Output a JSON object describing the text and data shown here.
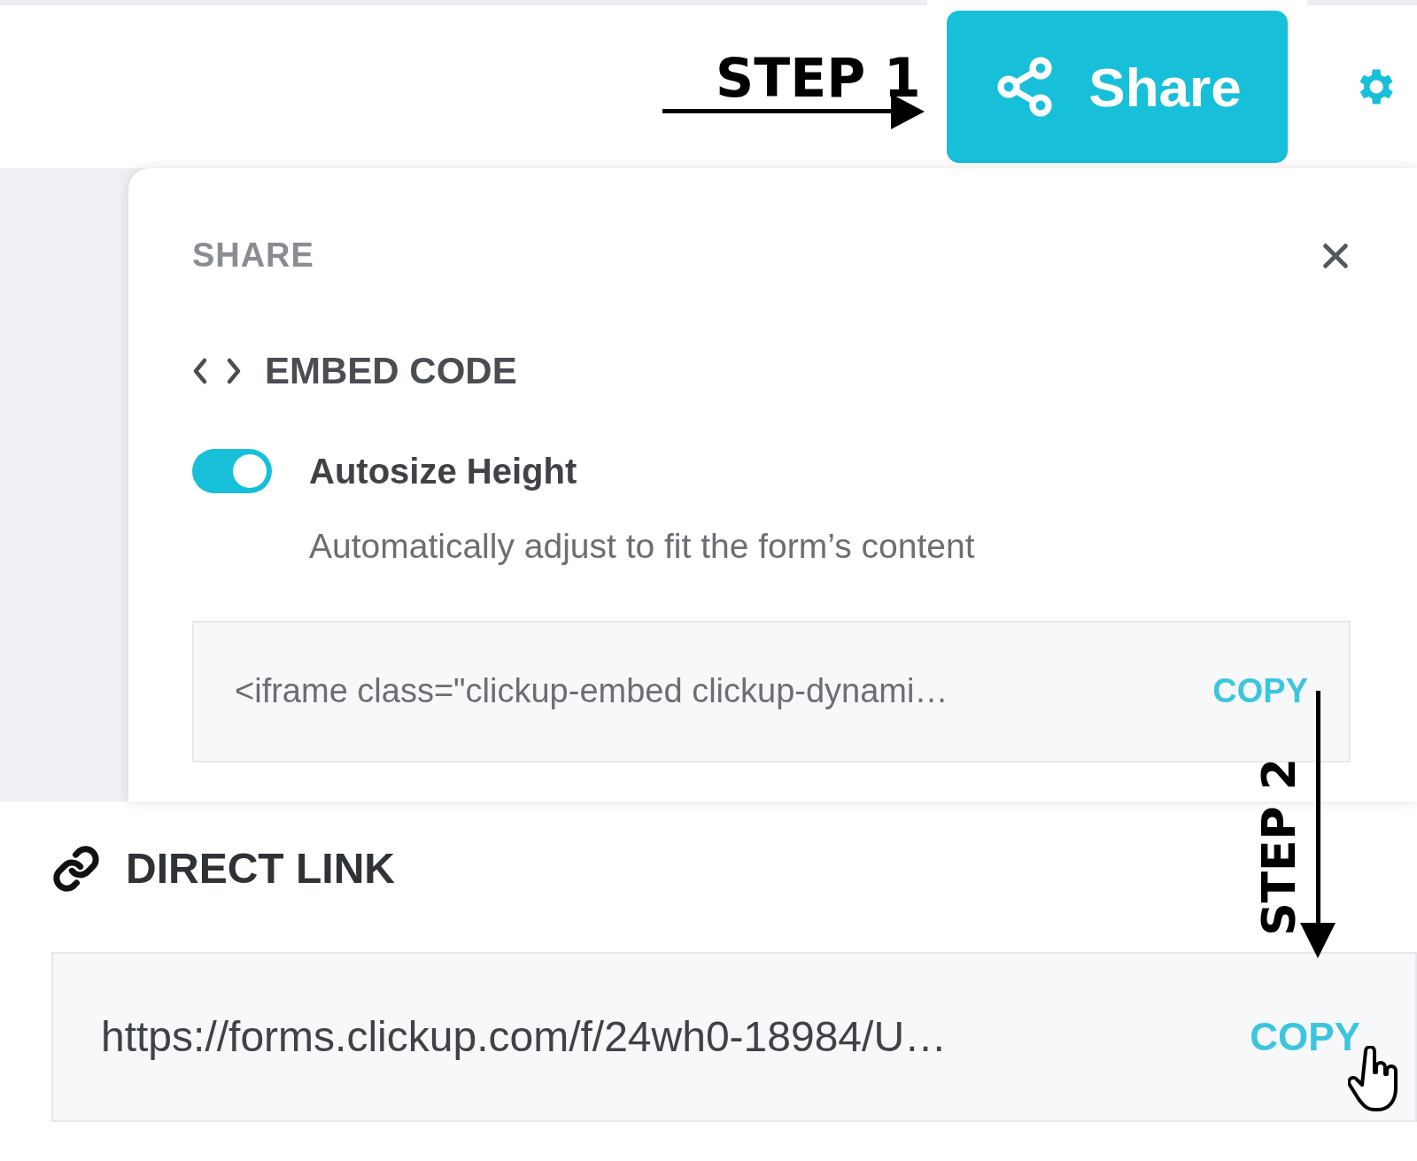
{
  "header": {
    "share_button": {
      "label": "Share"
    }
  },
  "annotations": [
    {
      "kind": "horizontal",
      "label": "STEP 1"
    },
    {
      "kind": "vertical",
      "label": "STEP 2"
    }
  ],
  "share_panel": {
    "title": "SHARE",
    "embed_code": {
      "heading": "EMBED CODE",
      "toggle": {
        "label": "Autosize Height",
        "on": true,
        "description": "Automatically adjust to fit the form’s content"
      },
      "code": "<iframe class=\"clickup-embed clickup-dynami…",
      "copy_label": "COPY"
    }
  },
  "direct_link": {
    "heading": "DIRECT LINK",
    "url": "https://forms.clickup.com/f/24wh0-18984/U…",
    "copy_label": "COPY"
  }
}
